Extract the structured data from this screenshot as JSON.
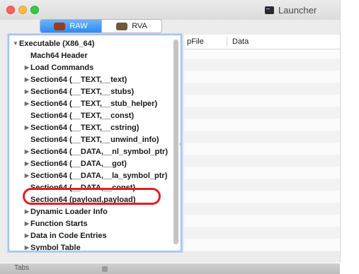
{
  "window": {
    "title": "Launcher"
  },
  "toolbar": {
    "segments": [
      {
        "label": "RAW",
        "icon": "raw-file-icon",
        "active": true
      },
      {
        "label": "RVA",
        "icon": "rva-file-icon",
        "active": false
      }
    ]
  },
  "tree": {
    "items": [
      {
        "label": "Executable  (X86_64)",
        "expandable": true,
        "expanded": true
      },
      {
        "label": "Mach64 Header",
        "expandable": false
      },
      {
        "label": "Load Commands",
        "expandable": true
      },
      {
        "label": "Section64 (__TEXT,__text)",
        "expandable": true
      },
      {
        "label": "Section64 (__TEXT,__stubs)",
        "expandable": true
      },
      {
        "label": "Section64 (__TEXT,__stub_helper)",
        "expandable": true
      },
      {
        "label": "Section64 (__TEXT,__const)",
        "expandable": false
      },
      {
        "label": "Section64 (__TEXT,__cstring)",
        "expandable": true
      },
      {
        "label": "Section64 (__TEXT,__unwind_info)",
        "expandable": false
      },
      {
        "label": "Section64 (__DATA,__nl_symbol_ptr)",
        "expandable": true
      },
      {
        "label": "Section64 (__DATA,__got)",
        "expandable": true
      },
      {
        "label": "Section64 (__DATA,__la_symbol_ptr)",
        "expandable": true
      },
      {
        "label": "Section64 (__DATA,__const)",
        "expandable": false
      },
      {
        "label": "Section64 (payload,payload)",
        "expandable": false,
        "highlighted": true
      },
      {
        "label": "Dynamic Loader Info",
        "expandable": true
      },
      {
        "label": "Function Starts",
        "expandable": true
      },
      {
        "label": "Data in Code Entries",
        "expandable": true
      },
      {
        "label": "Symbol Table",
        "expandable": true
      }
    ]
  },
  "table": {
    "columns": [
      "pFile",
      "Data"
    ]
  },
  "bottom": {
    "tab_label": "Tabs"
  },
  "colors": {
    "highlight": "#e31c24",
    "selection": "#2d8cf0"
  }
}
